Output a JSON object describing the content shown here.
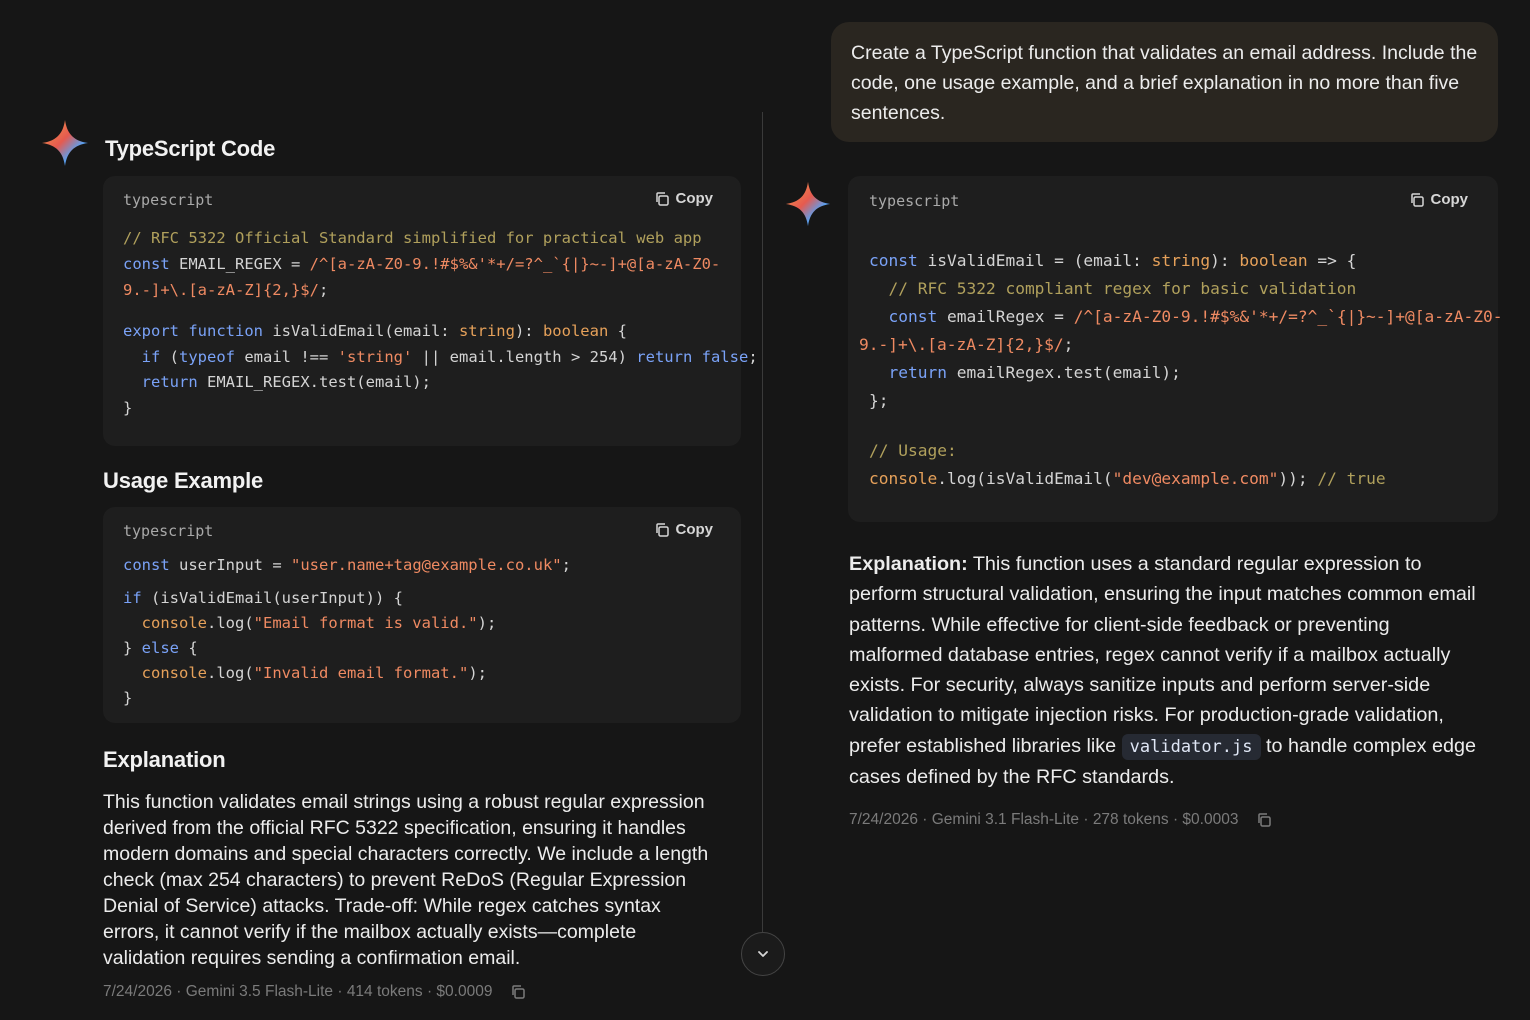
{
  "left": {
    "heading_code": "TypeScript Code",
    "code1": {
      "lang": "typescript",
      "copy_label": "Copy"
    },
    "heading_usage": "Usage Example",
    "code2": {
      "lang": "typescript",
      "copy_label": "Copy"
    },
    "heading_explanation": "Explanation",
    "explanation": "This function validates email strings using a robust regular expression derived from the official RFC 5322 specification, ensuring it handles modern domains and special characters correctly. We include a length check (max 254 characters) to prevent ReDoS (Regular Expression Denial of Service) attacks. Trade-off: While regex catches syntax errors, it cannot verify if the mailbox actually exists—complete validation requires sending a confirmation email.",
    "meta": "7/24/2026 · Gemini 3.5 Flash-Lite · 414 tokens · $0.0009"
  },
  "right": {
    "user_prompt": "Create a TypeScript function that validates an email address. Include the code, one usage example, and a brief explanation in no more than five sentences.",
    "code": {
      "lang": "typescript",
      "copy_label": "Copy"
    },
    "explanation_label": "Explanation:",
    "explanation_part1": " This function uses a standard regular expression to perform structural validation, ensuring the input matches common email patterns. While effective for client-side feedback or preventing malformed database entries, regex cannot verify if a mailbox actually exists. For security, always sanitize inputs and perform server-side validation to mitigate injection risks. For production-grade validation, prefer established libraries like ",
    "explanation_code": "validator.js",
    "explanation_part2": " to handle complex edge cases defined by the RFC standards.",
    "meta": "7/24/2026 · Gemini 3.1 Flash-Lite · 278 tokens · $0.0003"
  },
  "code_lines": {
    "l1": [
      {
        "t": "// RFC 5322 Official Standard simplified for practical web app",
        "c": "cmt"
      }
    ],
    "l1b": [
      {
        "t": "const",
        "c": "kw"
      },
      {
        "t": " EMAIL_REGEX = ",
        "c": ""
      },
      {
        "t": "/^[a-zA-Z0-9.!#$%&'*+/=?^_`{|}~-]+@[a-zA-Z0-",
        "c": "str"
      }
    ],
    "l1c": [
      {
        "t": "9.-]+\\.[a-zA-Z]{2,}$/",
        "c": "str"
      },
      {
        "t": ";",
        "c": ""
      }
    ],
    "l1d": [],
    "l1e": [
      {
        "t": "export",
        "c": "kw"
      },
      {
        "t": " ",
        "c": ""
      },
      {
        "t": "function",
        "c": "kw"
      },
      {
        "t": " isValidEmail(email: ",
        "c": ""
      },
      {
        "t": "string",
        "c": "type"
      },
      {
        "t": "): ",
        "c": ""
      },
      {
        "t": "boolean",
        "c": "type"
      },
      {
        "t": " {",
        "c": ""
      }
    ],
    "l1f": [
      {
        "t": "  ",
        "c": ""
      },
      {
        "t": "if",
        "c": "kw"
      },
      {
        "t": " (",
        "c": ""
      },
      {
        "t": "typeof",
        "c": "kw"
      },
      {
        "t": " email !== ",
        "c": ""
      },
      {
        "t": "'string'",
        "c": "str"
      },
      {
        "t": " || email.length > 254) ",
        "c": ""
      },
      {
        "t": "return",
        "c": "kw"
      },
      {
        "t": " ",
        "c": ""
      },
      {
        "t": "false",
        "c": "kw"
      },
      {
        "t": ";",
        "c": ""
      }
    ],
    "l1g": [
      {
        "t": "  ",
        "c": ""
      },
      {
        "t": "return",
        "c": "kw"
      },
      {
        "t": " EMAIL_REGEX.test(email);",
        "c": ""
      }
    ],
    "l1h": [
      {
        "t": "}",
        "c": ""
      }
    ],
    "u1": [
      {
        "t": "const",
        "c": "kw"
      },
      {
        "t": " userInput = ",
        "c": ""
      },
      {
        "t": "\"user.name+tag@example.co.uk\"",
        "c": "str"
      },
      {
        "t": ";",
        "c": ""
      }
    ],
    "u2": [
      {
        "t": "if",
        "c": "kw"
      },
      {
        "t": " (isValidEmail(userInput)) {",
        "c": ""
      }
    ],
    "u3": [
      {
        "t": "  ",
        "c": ""
      },
      {
        "t": "console",
        "c": "obj"
      },
      {
        "t": ".log(",
        "c": ""
      },
      {
        "t": "\"Email format is valid.\"",
        "c": "str"
      },
      {
        "t": ");",
        "c": ""
      }
    ],
    "u4": [
      {
        "t": "} ",
        "c": ""
      },
      {
        "t": "else",
        "c": "kw"
      },
      {
        "t": " {",
        "c": ""
      }
    ],
    "u5": [
      {
        "t": "  ",
        "c": ""
      },
      {
        "t": "console",
        "c": "obj"
      },
      {
        "t": ".log(",
        "c": ""
      },
      {
        "t": "\"Invalid email format.\"",
        "c": "str"
      },
      {
        "t": ");",
        "c": ""
      }
    ],
    "u6": [
      {
        "t": "}",
        "c": ""
      }
    ],
    "r1": [
      {
        "t": "const",
        "c": "kw"
      },
      {
        "t": " isValidEmail = (email: ",
        "c": ""
      },
      {
        "t": "string",
        "c": "type"
      },
      {
        "t": "): ",
        "c": ""
      },
      {
        "t": "boolean",
        "c": "type"
      },
      {
        "t": " => {",
        "c": ""
      }
    ],
    "r2": [
      {
        "t": "  ",
        "c": ""
      },
      {
        "t": "// RFC 5322 compliant regex for basic validation",
        "c": "cmt"
      }
    ],
    "r3": [
      {
        "t": "  ",
        "c": ""
      },
      {
        "t": "const",
        "c": "kw"
      },
      {
        "t": " emailRegex = ",
        "c": ""
      },
      {
        "t": "/^[a-zA-Z0-9.!#$%&'*+/=?^_`{|}~-]+@[a-zA-Z0-",
        "c": "str"
      }
    ],
    "r4": [
      {
        "t": "9.-]+\\.[a-zA-Z]{2,}$/",
        "c": "str"
      },
      {
        "t": ";",
        "c": ""
      }
    ],
    "r5": [
      {
        "t": "  ",
        "c": ""
      },
      {
        "t": "return",
        "c": "kw"
      },
      {
        "t": " emailRegex.test(email);",
        "c": ""
      }
    ],
    "r6": [
      {
        "t": "};",
        "c": ""
      }
    ],
    "r7": [],
    "r8": [
      {
        "t": "// Usage:",
        "c": "cmt"
      }
    ],
    "r9": [
      {
        "t": "console",
        "c": "obj"
      },
      {
        "t": ".log(isValidEmail(",
        "c": ""
      },
      {
        "t": "\"dev@example.com\"",
        "c": "str"
      },
      {
        "t": ")); ",
        "c": ""
      },
      {
        "t": "// true",
        "c": "cmt"
      }
    ]
  },
  "icons": {
    "assistant": "gemini-spark-icon",
    "copy": "copy-icon",
    "scroll": "chevron-down-icon"
  },
  "colors": {
    "background": "#161616",
    "code_bg": "#1e1e1e",
    "keyword": "#7aa2f7",
    "string": "#ef8a62",
    "comment": "#b0a05c",
    "user_bubble": "#2a2620"
  }
}
